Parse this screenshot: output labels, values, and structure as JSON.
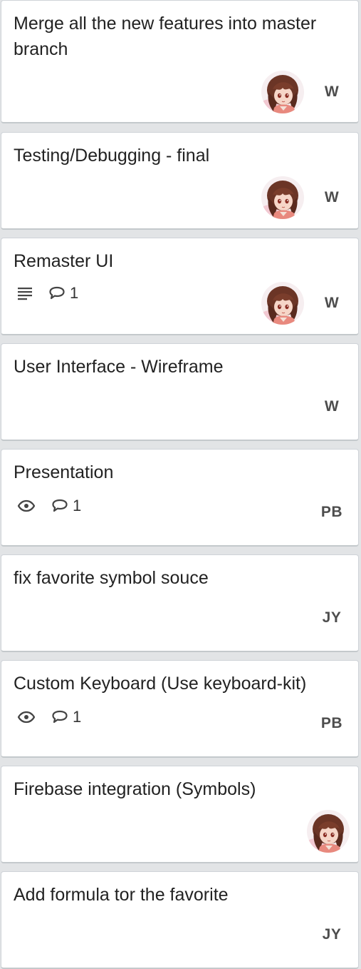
{
  "cards": [
    {
      "title": "Merge all the new features into master branch",
      "has_avatar": true,
      "initials": "W"
    },
    {
      "title": "Testing/Debugging - final",
      "has_avatar": true,
      "initials": "W"
    },
    {
      "title": "Remaster UI",
      "has_description": true,
      "comments": "1",
      "has_avatar": true,
      "initials": "W"
    },
    {
      "title": "User Interface - Wireframe",
      "initials": "W"
    },
    {
      "title": "Presentation",
      "watching": true,
      "comments": "1",
      "initials": "PB"
    },
    {
      "title": "fix favorite symbol souce",
      "initials": "JY"
    },
    {
      "title": "Custom Keyboard (Use keyboard-kit)",
      "watching": true,
      "comments": "1",
      "initials": "PB"
    },
    {
      "title": "Firebase integration (Symbols)",
      "has_avatar": true
    },
    {
      "title": "Add formula tor the favorite",
      "initials": "JY"
    }
  ],
  "icons": {
    "description": "description-lines-icon",
    "watch": "eye-icon",
    "comment": "speech-bubble-icon",
    "avatar": "member-avatar"
  },
  "colors": {
    "board_background": "#e2e4e6",
    "card_background": "#ffffff",
    "card_border": "#cfd3d8",
    "title_text": "#222222",
    "initials_text": "#4d4d4d",
    "badge_icon": "#444444"
  }
}
